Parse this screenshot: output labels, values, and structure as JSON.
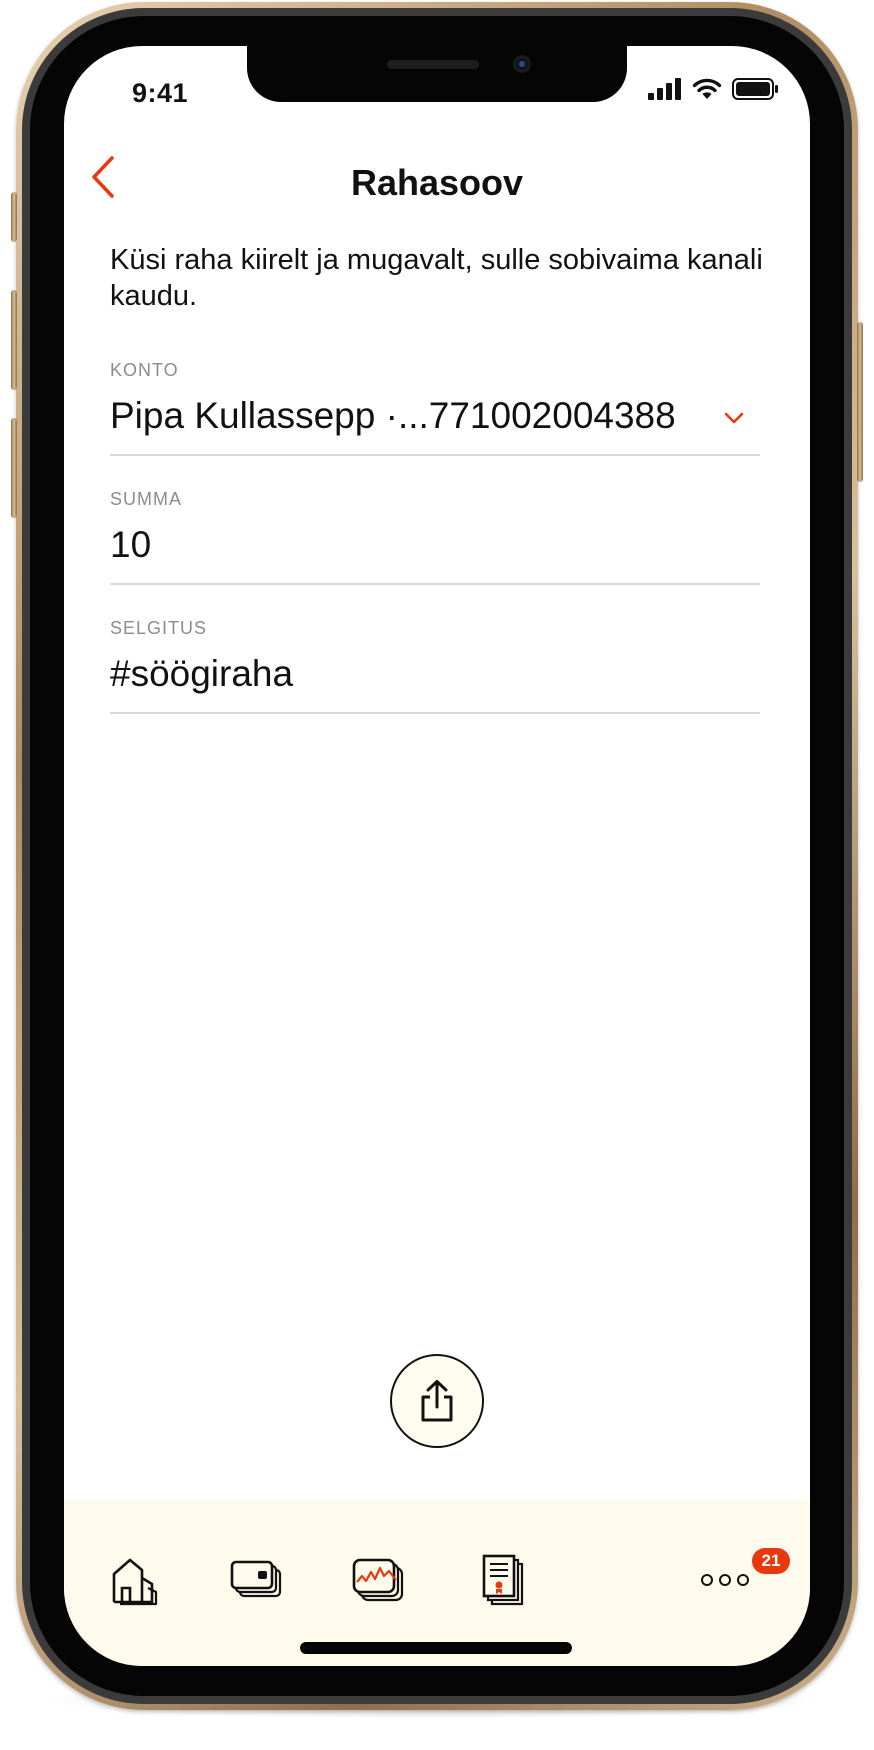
{
  "status_bar": {
    "time": "9:41"
  },
  "header": {
    "title": "Rahasoov"
  },
  "intro": "Küsi raha kiirelt ja mugavalt, sulle sobivaima kanali kaudu.",
  "fields": {
    "account": {
      "label": "KONTO",
      "value": "Pipa Kullassepp ·...771002004388"
    },
    "amount": {
      "label": "SUMMA",
      "value": "10"
    },
    "description": {
      "label": "SELGITUS",
      "value": "#söögiraha"
    }
  },
  "tabbar": {
    "more_badge": "21"
  },
  "colors": {
    "accent": "#e8380d",
    "tabbar_bg": "#fefaec",
    "divider": "#d8d8d8"
  }
}
